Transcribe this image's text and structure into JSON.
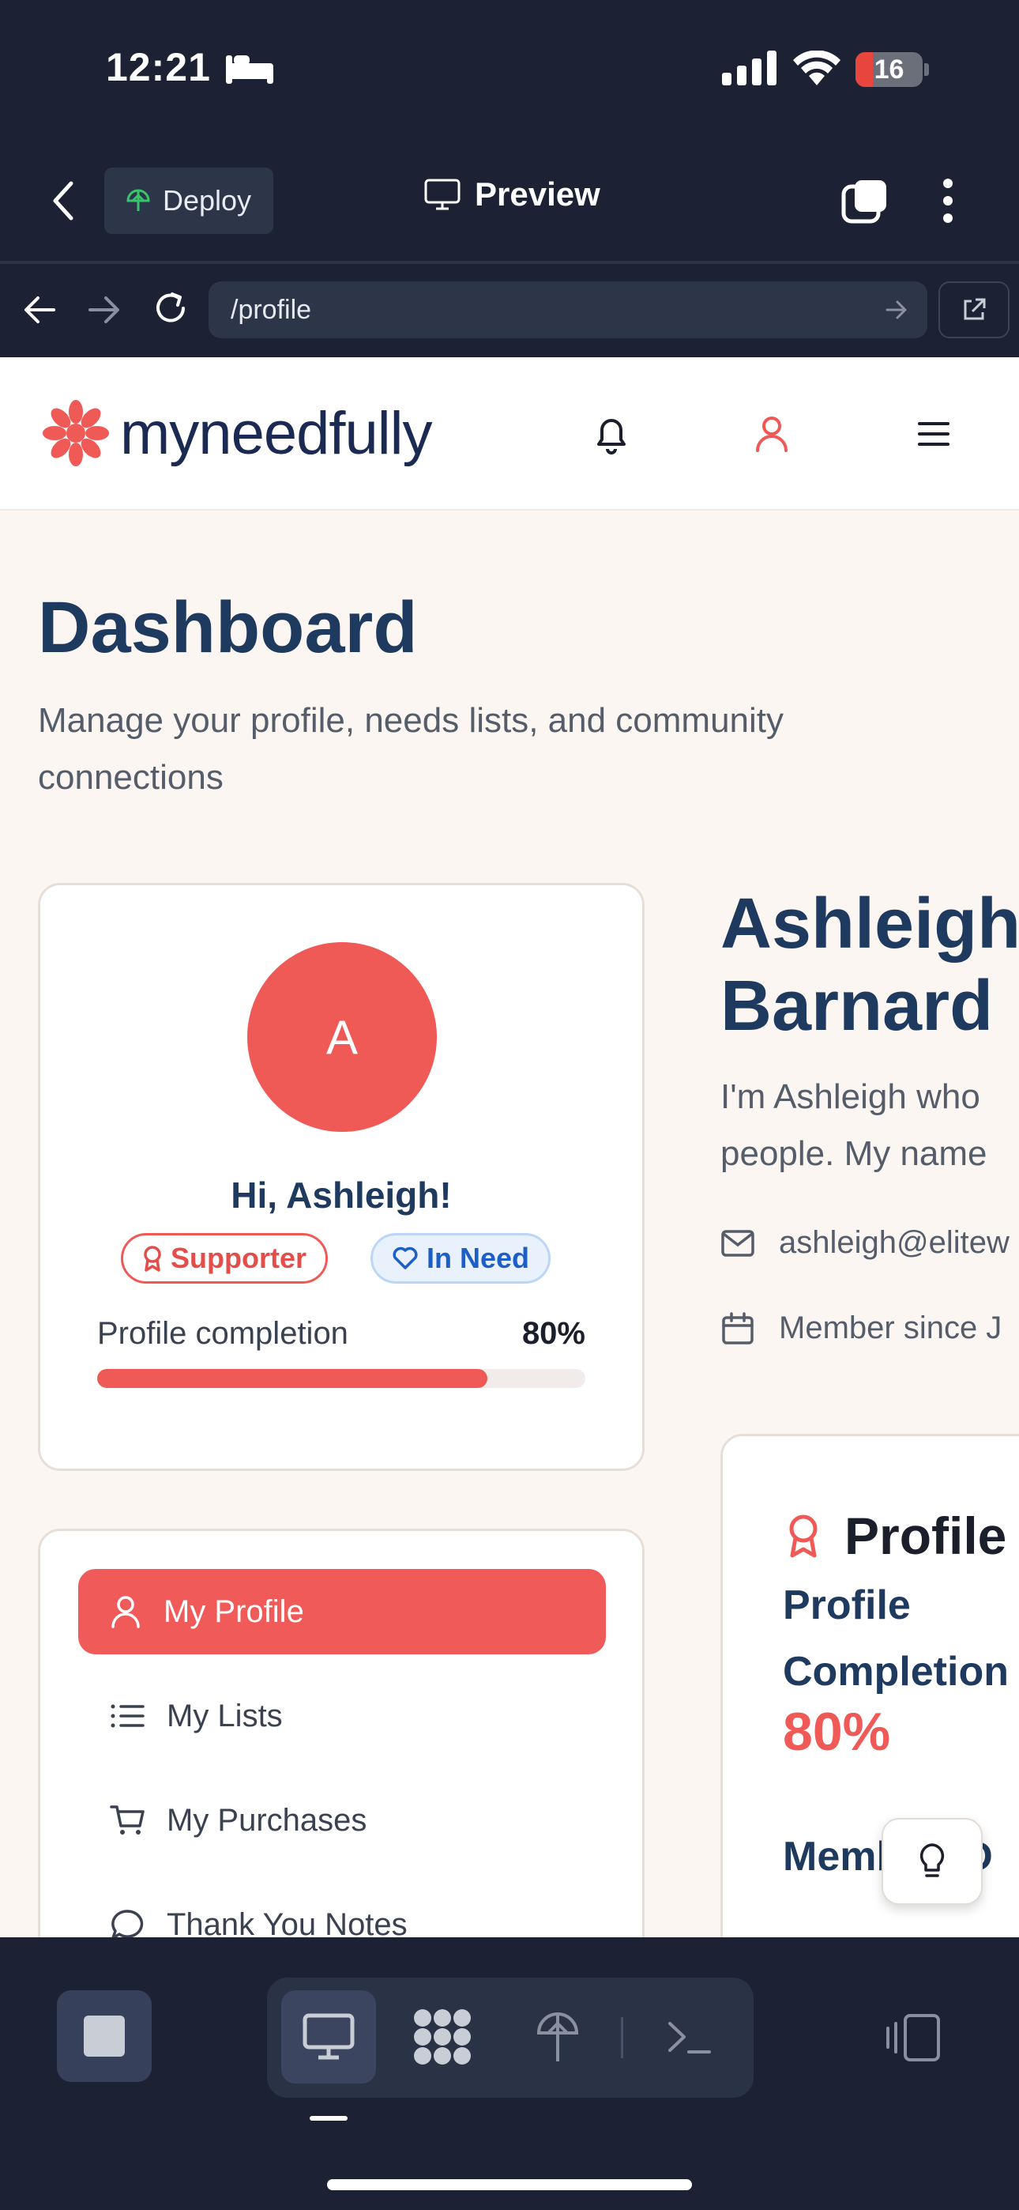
{
  "status_bar": {
    "time": "12:21",
    "battery": "16"
  },
  "app_toolbar": {
    "deploy_label": "Deploy",
    "preview_label": "Preview"
  },
  "url_bar": {
    "path": "/profile"
  },
  "site": {
    "brand_name": "myneedfully",
    "accent_color": "#ef5a57",
    "navy_color": "#1f3a5f"
  },
  "dashboard": {
    "title": "Dashboard",
    "subtitle": "Manage your profile, needs lists, and community connections"
  },
  "profile_card": {
    "avatar_initial": "A",
    "greeting": "Hi, Ashleigh!",
    "badges": {
      "supporter": "Supporter",
      "in_need": "In Need"
    },
    "completion_label": "Profile completion",
    "completion_value": "80%",
    "completion_fraction": 0.8
  },
  "nav": {
    "items": [
      {
        "label": "My Profile",
        "icon": "user-icon",
        "active": true
      },
      {
        "label": "My Lists",
        "icon": "list-icon"
      },
      {
        "label": "My Purchases",
        "icon": "cart-icon"
      },
      {
        "label": "Thank You Notes",
        "icon": "chat-bubble-icon"
      }
    ]
  },
  "profile_detail": {
    "name_line1": "Ashleigh",
    "name_line2": "Barnard",
    "bio_line1": "I'm Ashleigh who",
    "bio_line2": "people. My name",
    "email": "ashleigh@elitew",
    "member_since": "Member since J"
  },
  "overview": {
    "title": "Profile",
    "completion_label_1": "Profile",
    "completion_label_2": "Completion",
    "completion_value": "80%",
    "member_id_label": "Member ID"
  }
}
